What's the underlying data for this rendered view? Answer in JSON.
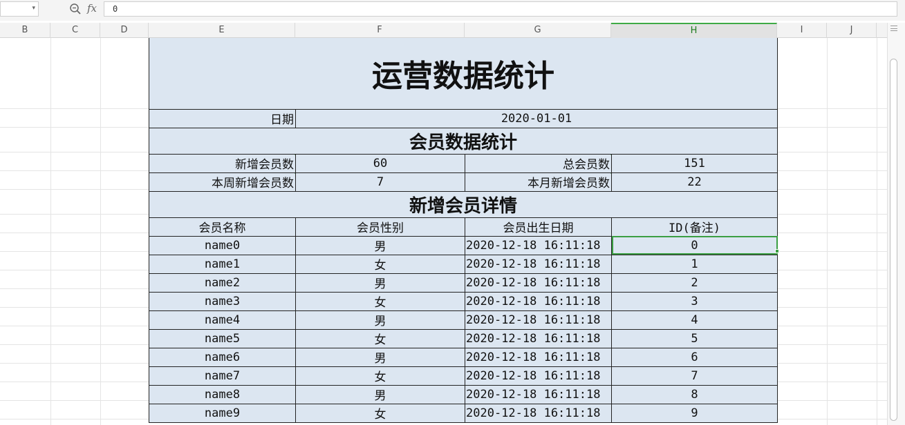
{
  "formula_bar": {
    "name_box": "",
    "fx_label": "fx",
    "content": "0"
  },
  "columns": [
    "B",
    "C",
    "D",
    "E",
    "F",
    "G",
    "H",
    "I",
    "J"
  ],
  "active_column": "H",
  "sheet": {
    "title": "运营数据统计",
    "date_label": "日期",
    "date_value": "2020-01-01",
    "member_section": "会员数据统计",
    "new_members_label": "新增会员数",
    "new_members_value": "60",
    "total_members_label": "总会员数",
    "total_members_value": "151",
    "week_new_label": "本周新增会员数",
    "week_new_value": "7",
    "month_new_label": "本月新增会员数",
    "month_new_value": "22",
    "detail_section": "新增会员详情",
    "headers": [
      "会员名称",
      "会员性别",
      "会员出生日期",
      "ID(备注)"
    ],
    "rows": [
      [
        "name0",
        "男",
        "2020-12-18 16:11:18",
        "0"
      ],
      [
        "name1",
        "女",
        "2020-12-18 16:11:18",
        "1"
      ],
      [
        "name2",
        "男",
        "2020-12-18 16:11:18",
        "2"
      ],
      [
        "name3",
        "女",
        "2020-12-18 16:11:18",
        "3"
      ],
      [
        "name4",
        "男",
        "2020-12-18 16:11:18",
        "4"
      ],
      [
        "name5",
        "女",
        "2020-12-18 16:11:18",
        "5"
      ],
      [
        "name6",
        "男",
        "2020-12-18 16:11:18",
        "6"
      ],
      [
        "name7",
        "女",
        "2020-12-18 16:11:18",
        "7"
      ],
      [
        "name8",
        "男",
        "2020-12-18 16:11:18",
        "8"
      ],
      [
        "name9",
        "女",
        "2020-12-18 16:11:18",
        "9"
      ]
    ]
  },
  "colors": {
    "cell_fill": "#dce6f1",
    "selection": "#3a9e42"
  }
}
